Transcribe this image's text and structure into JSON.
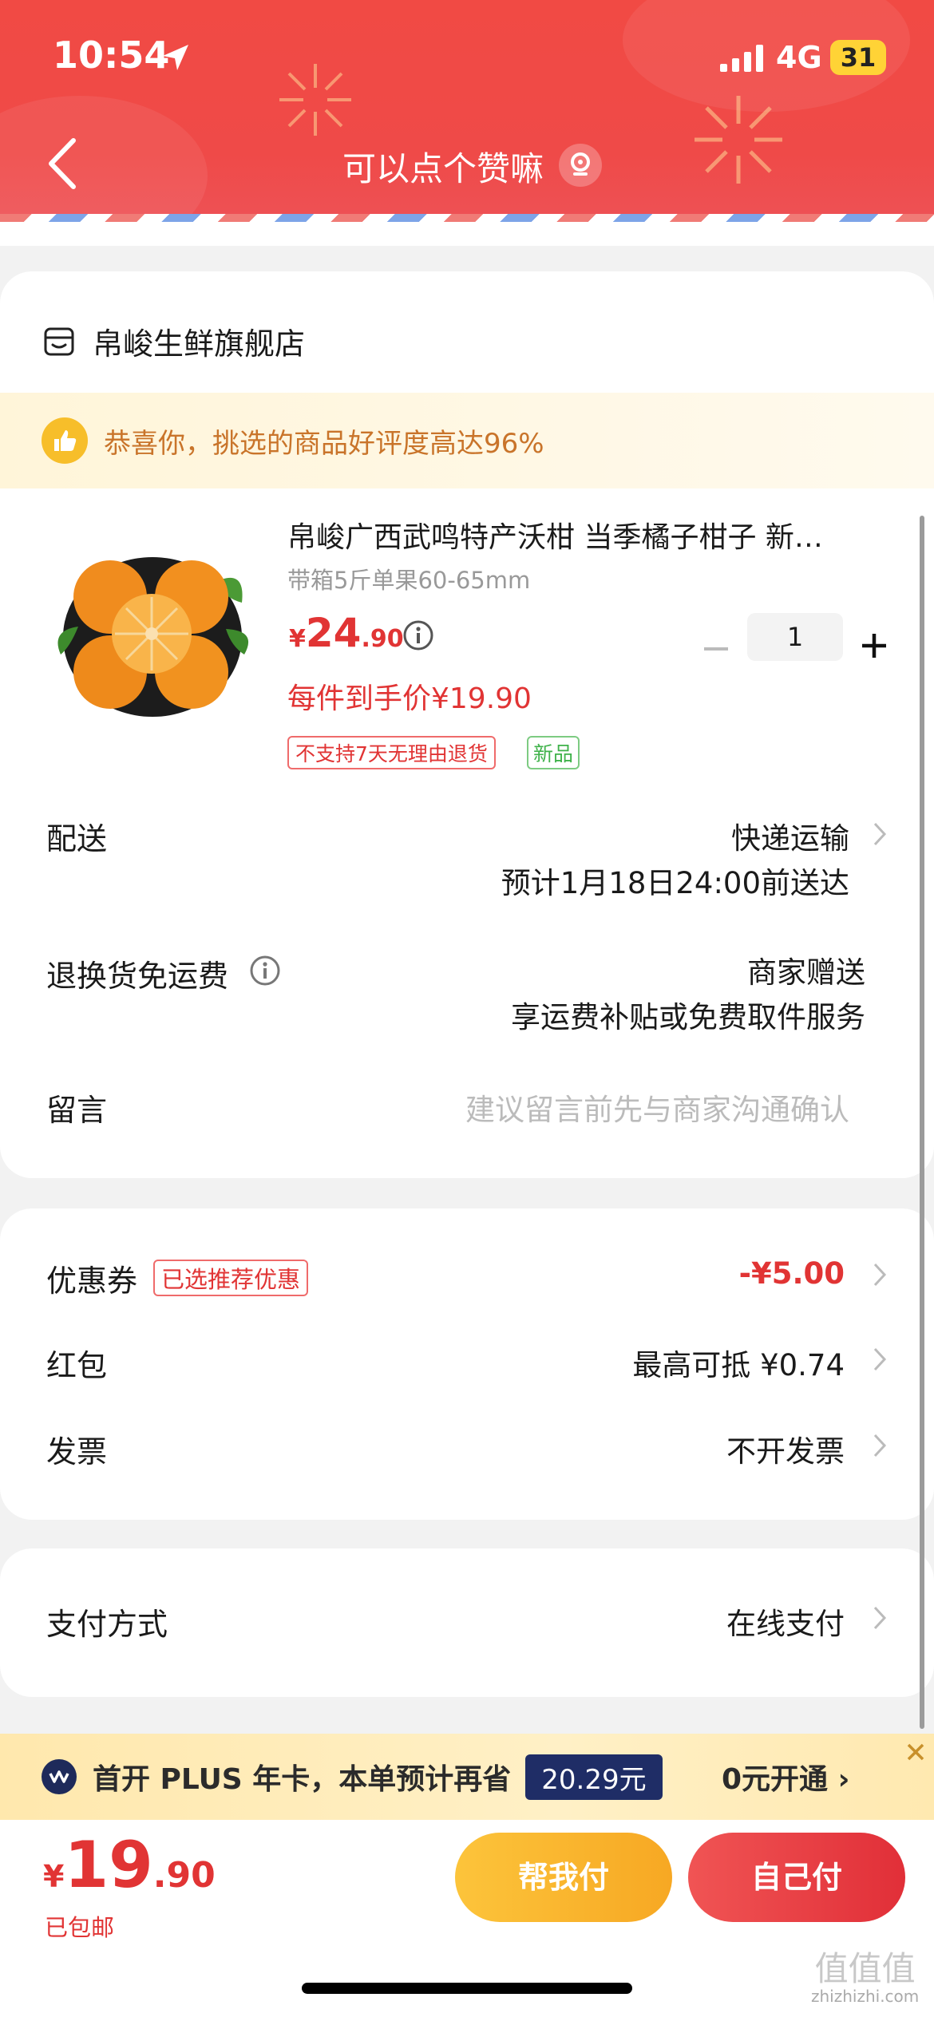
{
  "status_bar": {
    "time": "10:54",
    "network": "4G",
    "battery": "31"
  },
  "header": {
    "title": "可以点个赞嘛"
  },
  "shop": {
    "name": "帛峻生鲜旗舰店"
  },
  "praise": {
    "text": "恭喜你，挑选的商品好评度高达96%"
  },
  "product": {
    "name": "帛峻广西武鸣特产沃柑 当季橘子柑子 新…",
    "spec": "带箱5斤单果60-65mm",
    "price_symbol": "¥",
    "price_int": "24",
    "price_dec": ".90",
    "deal_price": "每件到手价¥19.90",
    "tags": [
      "不支持7天无理由退货",
      "新品"
    ],
    "quantity": "1"
  },
  "delivery": {
    "label": "配送",
    "method": "快递运输",
    "eta": "预计1月18日24:00前送达"
  },
  "return_fee": {
    "label": "退换货免运费",
    "value1": "商家赠送",
    "value2": "享运费补贴或免费取件服务"
  },
  "message": {
    "label": "留言",
    "placeholder": "建议留言前先与商家沟通确认"
  },
  "coupon": {
    "label": "优惠券",
    "tag": "已选推荐优惠",
    "value": "-¥5.00"
  },
  "red_packet": {
    "label": "红包",
    "value": "最高可抵 ¥0.74"
  },
  "invoice": {
    "label": "发票",
    "value": "不开发票"
  },
  "payment": {
    "label": "支付方式",
    "value": "在线支付"
  },
  "plus_banner": {
    "text": "首开 PLUS 年卡，本单预计再省",
    "amount": "20.29元",
    "action": "0元开通 ›"
  },
  "bottom": {
    "total_symbol": "¥",
    "total_int": "19",
    "total_dec": ".90",
    "shipping": "已包邮",
    "help_pay": "帮我付",
    "self_pay": "自己付"
  },
  "watermark": {
    "line1": "值值值",
    "line2": "zhizhizhi.com"
  },
  "colors": {
    "brand_red": "#e13434",
    "header_red": "#f14a44",
    "gold": "#f7a823",
    "plus_navy": "#1f2d66"
  }
}
